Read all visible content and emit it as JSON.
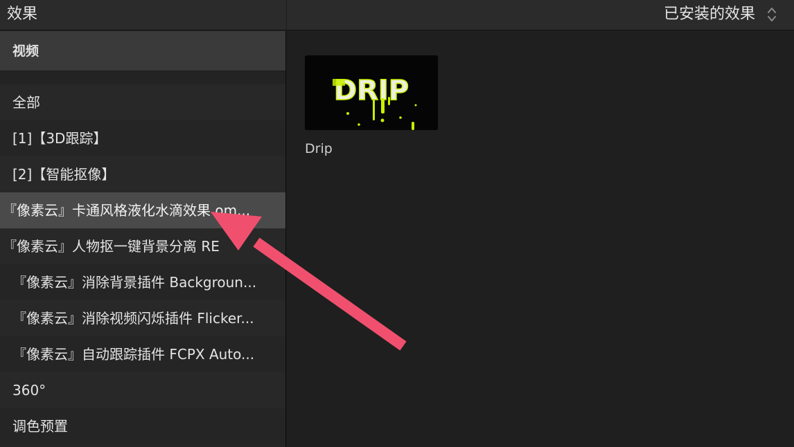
{
  "left_panel": {
    "title": "效果",
    "section": "视频",
    "items": [
      {
        "label": "全部"
      },
      {
        "label": "[1]【3D跟踪】"
      },
      {
        "label": "[2]【智能抠像】"
      },
      {
        "label": "『像素云』卡通风格液化水滴效果 om..."
      },
      {
        "label": "『像素云』人物抠一键背景分离 RE"
      },
      {
        "label": "『像素云』消除背景插件 Backgroun..."
      },
      {
        "label": "『像素云』消除视频闪烁插件 Flicker..."
      },
      {
        "label": "『像素云』自动跟踪插件 FCPX Auto..."
      },
      {
        "label": "360°"
      },
      {
        "label": "调色预置"
      }
    ],
    "selected_index": 3
  },
  "right_panel": {
    "filter_label": "已安装的效果",
    "effects": [
      {
        "name": "Drip",
        "thumbnail_text": "DRIP"
      }
    ]
  },
  "colors": {
    "accent_arrow": "#f0506e",
    "drip_yellow": "#c8f000"
  }
}
